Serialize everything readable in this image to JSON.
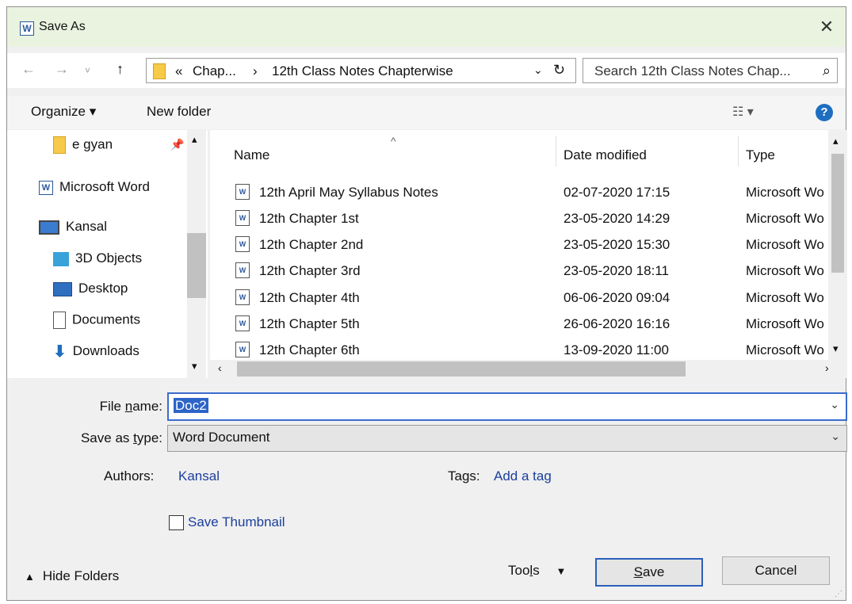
{
  "window": {
    "title": "Save As",
    "app_icon_letter": "W"
  },
  "nav": {
    "back_icon": "back-arrow-icon",
    "forward_icon": "forward-arrow-icon",
    "recent_icon": "chevron-down-icon",
    "up_icon": "up-arrow-icon",
    "breadcrumb": [
      "«",
      "Chap...",
      "›",
      "12th Class Notes Chapterwise"
    ],
    "search_placeholder": "Search 12th Class Notes Chap..."
  },
  "toolbar": {
    "organize_label": "Organize ▾",
    "new_folder_label": "New folder",
    "help_label": "?"
  },
  "navpane": {
    "items": [
      {
        "label": "e gyan",
        "icon": "folder-icon"
      },
      {
        "label": "Microsoft Word",
        "icon": "word-icon"
      },
      {
        "label": "Kansal",
        "icon": "computer-icon"
      },
      {
        "label": "3D Objects",
        "icon": "3d-objects-icon"
      },
      {
        "label": "Desktop",
        "icon": "desktop-icon"
      },
      {
        "label": "Documents",
        "icon": "documents-icon"
      },
      {
        "label": "Downloads",
        "icon": "downloads-icon"
      }
    ]
  },
  "filelist": {
    "columns": [
      "Name",
      "Date modified",
      "Type"
    ],
    "rows": [
      {
        "name": "12th April May Syllabus Notes",
        "date": "02-07-2020 17:15",
        "type": "Microsoft Wo"
      },
      {
        "name": "12th Chapter 1st",
        "date": "23-05-2020 14:29",
        "type": "Microsoft Wo"
      },
      {
        "name": "12th Chapter 2nd",
        "date": "23-05-2020 15:30",
        "type": "Microsoft Wo"
      },
      {
        "name": "12th Chapter 3rd",
        "date": "23-05-2020 18:11",
        "type": "Microsoft Wo"
      },
      {
        "name": "12th Chapter 4th",
        "date": "06-06-2020 09:04",
        "type": "Microsoft Wo"
      },
      {
        "name": "12th Chapter 5th",
        "date": "26-06-2020 16:16",
        "type": "Microsoft Wo"
      },
      {
        "name": "12th Chapter 6th",
        "date": "13-09-2020 11:00",
        "type": "Microsoft Wo"
      }
    ]
  },
  "form": {
    "file_name_label_pre": "File ",
    "file_name_label_u": "n",
    "file_name_label_post": "ame:",
    "file_name_value": "Doc2",
    "save_type_label_pre": "Save as ",
    "save_type_label_u": "t",
    "save_type_label_post": "ype:",
    "save_type_value": "Word Document",
    "authors_label": "Authors:",
    "authors_value": "Kansal",
    "tags_label": "Tags:",
    "tags_value": "Add a tag",
    "thumbnail_label": "Save Thumbnail"
  },
  "footer": {
    "hide_folders_label": "Hide Folders",
    "tools_label_pre": "Too",
    "tools_label_u": "l",
    "tools_label_post": "s",
    "save_label_u": "S",
    "save_label_post": "ave",
    "cancel_label": "Cancel"
  },
  "colors": {
    "titlebar_bg": "#e9f3df",
    "accent": "#2d64c8",
    "link": "#1a3f9c"
  }
}
